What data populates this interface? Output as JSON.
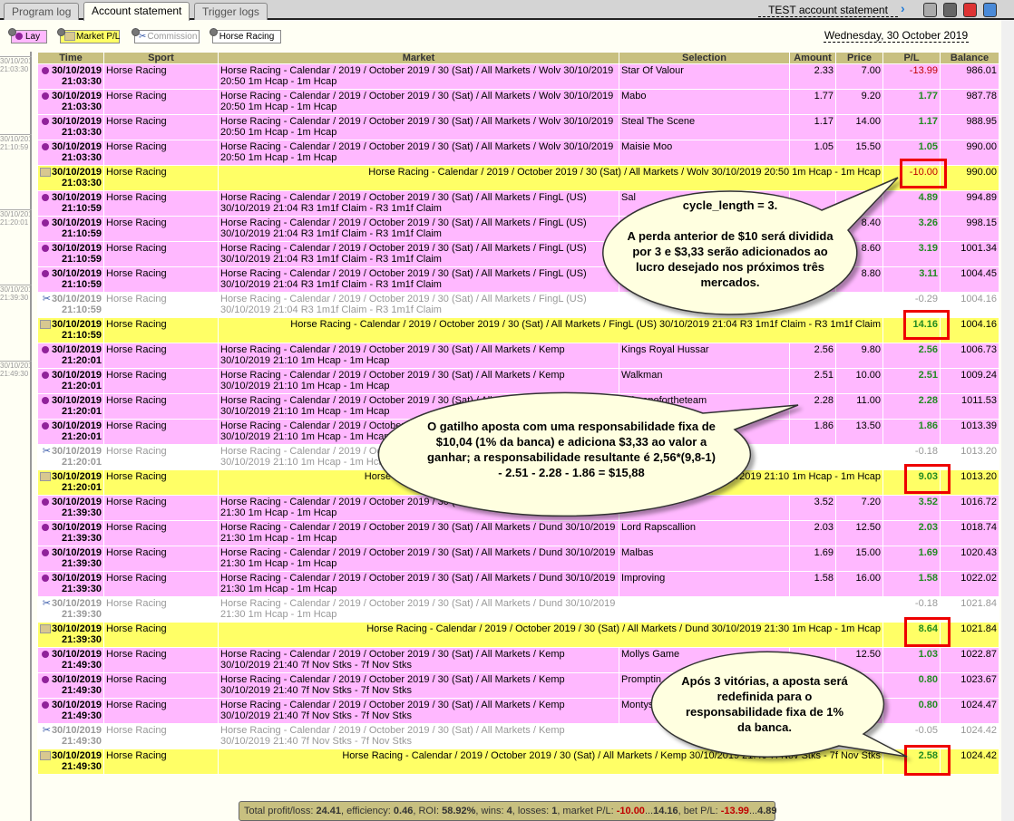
{
  "tabs": [
    {
      "label": "Program log"
    },
    {
      "label": "Account statement",
      "active": true
    },
    {
      "label": "Trigger logs"
    }
  ],
  "account_title": "TEST account statement",
  "toolbar_icons": [
    "arrow-right-icon",
    "refresh-icon",
    "save-icon",
    "print-icon",
    "download-icon"
  ],
  "filters": [
    {
      "label": "Lay",
      "icon": "lay-dot-icon",
      "color": "#ffb8ff"
    },
    {
      "label": "Market P/L",
      "icon": "market-pl-icon",
      "color": "#ffff66"
    },
    {
      "label": "Commission",
      "icon": "scissors-icon",
      "color": "#ffffff"
    },
    {
      "label": "Horse Racing",
      "icon": "",
      "color": "#ffffff"
    }
  ],
  "date": "Wednesday, 30 October 2019",
  "left_markers": [
    {
      "date": "30/10/2019",
      "time": "21:03:30"
    },
    {
      "date": "30/10/2019",
      "time": "21:10:59"
    },
    {
      "date": "30/10/2019",
      "time": "21:20:01"
    },
    {
      "date": "30/10/2019",
      "time": "21:39:30"
    },
    {
      "date": "30/10/2019",
      "time": "21:49:30"
    }
  ],
  "columns": [
    "Time",
    "Sport",
    "Market",
    "Selection",
    "Amount",
    "Price",
    "P/L",
    "Balance"
  ],
  "rows": [
    {
      "type": "lay",
      "date": "30/10/2019",
      "time": "21:03:30",
      "sport": "Horse Racing",
      "market": "Horse Racing - Calendar / 2019 / October 2019 / 30 (Sat) / All Markets / Wolv 30/10/2019 20:50 1m Hcap - 1m Hcap",
      "selection": "Star Of Valour",
      "amount": "2.33",
      "price": "7.00",
      "pl": "-13.99",
      "balance": "986.01"
    },
    {
      "type": "lay",
      "date": "30/10/2019",
      "time": "21:03:30",
      "sport": "Horse Racing",
      "market": "Horse Racing - Calendar / 2019 / October 2019 / 30 (Sat) / All Markets / Wolv 30/10/2019 20:50 1m Hcap - 1m Hcap",
      "selection": "Mabo",
      "amount": "1.77",
      "price": "9.20",
      "pl": "1.77",
      "balance": "987.78"
    },
    {
      "type": "lay",
      "date": "30/10/2019",
      "time": "21:03:30",
      "sport": "Horse Racing",
      "market": "Horse Racing - Calendar / 2019 / October 2019 / 30 (Sat) / All Markets / Wolv 30/10/2019 20:50 1m Hcap - 1m Hcap",
      "selection": "Steal The Scene",
      "amount": "1.17",
      "price": "14.00",
      "pl": "1.17",
      "balance": "988.95"
    },
    {
      "type": "lay",
      "date": "30/10/2019",
      "time": "21:03:30",
      "sport": "Horse Racing",
      "market": "Horse Racing - Calendar / 2019 / October 2019 / 30 (Sat) / All Markets / Wolv 30/10/2019 20:50 1m Hcap - 1m Hcap",
      "selection": "Maisie Moo",
      "amount": "1.05",
      "price": "15.50",
      "pl": "1.05",
      "balance": "990.00"
    },
    {
      "type": "mkt",
      "date": "30/10/2019",
      "time": "21:03:30",
      "sport": "Horse Racing",
      "market": "Horse Racing - Calendar / 2019 / October 2019 / 30 (Sat) / All Markets / Wolv 30/10/2019 20:50 1m Hcap - 1m Hcap",
      "pl": "-10.00",
      "balance": "990.00"
    },
    {
      "type": "lay",
      "date": "30/10/2019",
      "time": "21:10:59",
      "sport": "Horse Racing",
      "market": "Horse Racing - Calendar / 2019 / October 2019 / 30 (Sat) / All Markets / FingL (US) 30/10/2019 21:04 R3 1m1f Claim - R3 1m1f Claim",
      "selection": "Sal",
      "amount": "",
      "price": "",
      "pl": "4.89",
      "balance": "994.89"
    },
    {
      "type": "lay",
      "date": "30/10/2019",
      "time": "21:10:59",
      "sport": "Horse Racing",
      "market": "Horse Racing - Calendar / 2019 / October 2019 / 30 (Sat) / All Markets / FingL (US) 30/10/2019 21:04 R3 1m1f Claim - R3 1m1f Claim",
      "selection": "",
      "amount": "",
      "price": "8.40",
      "pl": "3.26",
      "balance": "998.15"
    },
    {
      "type": "lay",
      "date": "30/10/2019",
      "time": "21:10:59",
      "sport": "Horse Racing",
      "market": "Horse Racing - Calendar / 2019 / October 2019 / 30 (Sat) / All Markets / FingL (US) 30/10/2019 21:04 R3 1m1f Claim - R3 1m1f Claim",
      "selection": "",
      "amount": "",
      "price": "8.60",
      "pl": "3.19",
      "balance": "1001.34"
    },
    {
      "type": "lay",
      "date": "30/10/2019",
      "time": "21:10:59",
      "sport": "Horse Racing",
      "market": "Horse Racing - Calendar / 2019 / October 2019 / 30 (Sat) / All Markets / FingL (US) 30/10/2019 21:04 R3 1m1f Claim - R3 1m1f Claim",
      "selection": "",
      "amount": "",
      "price": "8.80",
      "pl": "3.11",
      "balance": "1004.45"
    },
    {
      "type": "comm",
      "date": "30/10/2019",
      "time": "21:10:59",
      "sport": "Horse Racing",
      "market": "Horse Racing - Calendar / 2019 / October 2019 / 30 (Sat) / All Markets / FingL (US) 30/10/2019 21:04 R3 1m1f Claim - R3 1m1f Claim",
      "selection": "",
      "amount": "",
      "price": "",
      "pl": "-0.29",
      "balance": "1004.16"
    },
    {
      "type": "mkt",
      "date": "30/10/2019",
      "time": "21:10:59",
      "sport": "Horse Racing",
      "market": "Horse Racing - Calendar / 2019 / October 2019 / 30 (Sat) / All Markets / FingL (US) 30/10/2019 21:04 R3 1m1f Claim - R3 1m1f Claim",
      "pl": "14.16",
      "balance": "1004.16"
    },
    {
      "type": "lay",
      "date": "30/10/2019",
      "time": "21:20:01",
      "sport": "Horse Racing",
      "market": "Horse Racing - Calendar / 2019 / October 2019 / 30 (Sat) / All Markets / Kemp 30/10/2019 21:10 1m Hcap - 1m Hcap",
      "selection": "Kings Royal Hussar",
      "amount": "2.56",
      "price": "9.80",
      "pl": "2.56",
      "balance": "1006.73"
    },
    {
      "type": "lay",
      "date": "30/10/2019",
      "time": "21:20:01",
      "sport": "Horse Racing",
      "market": "Horse Racing - Calendar / 2019 / October 2019 / 30 (Sat) / All Markets / Kemp 30/10/2019 21:10 1m Hcap - 1m Hcap",
      "selection": "Walkman",
      "amount": "2.51",
      "price": "10.00",
      "pl": "2.51",
      "balance": "1009.24"
    },
    {
      "type": "lay",
      "date": "30/10/2019",
      "time": "21:20:01",
      "sport": "Horse Racing",
      "market": "Horse Racing - Calendar / 2019 / October 2019 / 30 (Sat) / All Markets / Kemp 30/10/2019 21:10 1m Hcap - 1m Hcap",
      "selection": "Takeonefortheteam",
      "amount": "2.28",
      "price": "11.00",
      "pl": "2.28",
      "balance": "1011.53"
    },
    {
      "type": "lay",
      "date": "30/10/2019",
      "time": "21:20:01",
      "sport": "Horse Racing",
      "market": "Horse Racing - Calendar / 2019 / October 2019 / 30 (Sat) / All Markets / Kemp 30/10/2019 21:10 1m Hcap - 1m Hcap",
      "selection": "",
      "amount": "1.86",
      "price": "13.50",
      "pl": "1.86",
      "balance": "1013.39"
    },
    {
      "type": "comm",
      "date": "30/10/2019",
      "time": "21:20:01",
      "sport": "Horse Racing",
      "market": "Horse Racing - Calendar / 2019 / October 2019 / 30 (Sat) / All Markets / Kemp 30/10/2019 21:10 1m Hcap - 1m Hcap",
      "selection": "",
      "amount": "",
      "price": "",
      "pl": "-0.18",
      "balance": "1013.20"
    },
    {
      "type": "mkt",
      "date": "30/10/2019",
      "time": "21:20:01",
      "sport": "Horse Racing",
      "market": "Horse Racing - Calendar / 2019 / October 2019 / 30 (Sat) / All Markets / Kemp 30/10/2019 21:10 1m Hcap - 1m Hcap",
      "pl": "9.03",
      "balance": "1013.20"
    },
    {
      "type": "lay",
      "date": "30/10/2019",
      "time": "21:39:30",
      "sport": "Horse Racing",
      "market": "Horse Racing - Calendar / 2019 / October 2019 / 30 (Sat) / All Markets / Dund 30/10/2019 21:30 1m Hcap - 1m Hcap",
      "selection": "",
      "amount": "3.52",
      "price": "7.20",
      "pl": "3.52",
      "balance": "1016.72"
    },
    {
      "type": "lay",
      "date": "30/10/2019",
      "time": "21:39:30",
      "sport": "Horse Racing",
      "market": "Horse Racing - Calendar / 2019 / October 2019 / 30 (Sat) / All Markets / Dund 30/10/2019 21:30 1m Hcap - 1m Hcap",
      "selection": "Lord Rapscallion",
      "amount": "2.03",
      "price": "12.50",
      "pl": "2.03",
      "balance": "1018.74"
    },
    {
      "type": "lay",
      "date": "30/10/2019",
      "time": "21:39:30",
      "sport": "Horse Racing",
      "market": "Horse Racing - Calendar / 2019 / October 2019 / 30 (Sat) / All Markets / Dund 30/10/2019 21:30 1m Hcap - 1m Hcap",
      "selection": "Malbas",
      "amount": "1.69",
      "price": "15.00",
      "pl": "1.69",
      "balance": "1020.43"
    },
    {
      "type": "lay",
      "date": "30/10/2019",
      "time": "21:39:30",
      "sport": "Horse Racing",
      "market": "Horse Racing - Calendar / 2019 / October 2019 / 30 (Sat) / All Markets / Dund 30/10/2019 21:30 1m Hcap - 1m Hcap",
      "selection": "Improving",
      "amount": "1.58",
      "price": "16.00",
      "pl": "1.58",
      "balance": "1022.02"
    },
    {
      "type": "comm",
      "date": "30/10/2019",
      "time": "21:39:30",
      "sport": "Horse Racing",
      "market": "Horse Racing - Calendar / 2019 / October 2019 / 30 (Sat) / All Markets / Dund 30/10/2019 21:30 1m Hcap - 1m Hcap",
      "selection": "",
      "amount": "",
      "price": "",
      "pl": "-0.18",
      "balance": "1021.84"
    },
    {
      "type": "mkt",
      "date": "30/10/2019",
      "time": "21:39:30",
      "sport": "Horse Racing",
      "market": "Horse Racing - Calendar / 2019 / October 2019 / 30 (Sat) / All Markets / Dund 30/10/2019 21:30 1m Hcap - 1m Hcap",
      "pl": "8.64",
      "balance": "1021.84"
    },
    {
      "type": "lay",
      "date": "30/10/2019",
      "time": "21:49:30",
      "sport": "Horse Racing",
      "market": "Horse Racing - Calendar / 2019 / October 2019 / 30 (Sat) / All Markets / Kemp 30/10/2019 21:40 7f Nov Stks - 7f Nov Stks",
      "selection": "Mollys Game",
      "amount": "",
      "price": "12.50",
      "pl": "1.03",
      "balance": "1022.87"
    },
    {
      "type": "lay",
      "date": "30/10/2019",
      "time": "21:49:30",
      "sport": "Horse Racing",
      "market": "Horse Racing - Calendar / 2019 / October 2019 / 30 (Sat) / All Markets / Kemp 30/10/2019 21:40 7f Nov Stks - 7f Nov Stks",
      "selection": "Promptin",
      "amount": "",
      "price": "",
      "pl": "0.80",
      "balance": "1023.67"
    },
    {
      "type": "lay",
      "date": "30/10/2019",
      "time": "21:49:30",
      "sport": "Horse Racing",
      "market": "Horse Racing - Calendar / 2019 / October 2019 / 30 (Sat) / All Markets / Kemp 30/10/2019 21:40 7f Nov Stks - 7f Nov Stks",
      "selection": "Montys",
      "amount": "",
      "price": "",
      "pl": "0.80",
      "balance": "1024.47"
    },
    {
      "type": "comm",
      "date": "30/10/2019",
      "time": "21:49:30",
      "sport": "Horse Racing",
      "market": "Horse Racing - Calendar / 2019 / October 2019 / 30 (Sat) / All Markets / Kemp 30/10/2019 21:40 7f Nov Stks - 7f Nov Stks",
      "selection": "",
      "amount": "",
      "price": "",
      "pl": "-0.05",
      "balance": "1024.42"
    },
    {
      "type": "mkt",
      "date": "30/10/2019",
      "time": "21:49:30",
      "sport": "Horse Racing",
      "market": "Horse Racing - Calendar / 2019 / October 2019 / 30 (Sat) / All Markets / Kemp 30/10/2019 21:40 7f Nov Stks - 7f Nov Stks",
      "pl": "2.58",
      "balance": "1024.42"
    }
  ],
  "footer": {
    "l1": "Total profit/loss: ",
    "v1": "24.41",
    "l2": ", efficiency: ",
    "v2": "0.46",
    "l3": ", ROI: ",
    "v3": "58.92%",
    "l4": ", wins: ",
    "v4": "4",
    "l5": ", losses: ",
    "v5": "1",
    "l6": ", market P/L: ",
    "v6": "-10.00",
    "sep1": "...",
    "v7": "14.16",
    "l7": ", bet P/L: ",
    "v8": "-13.99",
    "sep2": "...",
    "v9": "4.89"
  },
  "callouts": [
    {
      "text": "cycle_length = 3.\n\nA perda anterior de $10 será dividida por 3 e $3,33 serão adicionados ao lucro desejado nos próximos três mercados."
    },
    {
      "text": "O gatilho aposta com uma responsabilidade fixa de $10,04 (1% da banca) e adiciona $3,33 ao valor a ganhar; a responsabilidade resultante é 2,56*(9,8-1) - 2.51 - 2.28 - 1.86 = $15,88"
    },
    {
      "text": "Após 3 vitórias, a aposta será redefinida para o responsabilidade fixa de 1% da banca."
    }
  ],
  "colors": {
    "lay": "#ffb8ff",
    "market_pl": "#ffff66",
    "header": "#c8c080",
    "callout": "#ffffe0",
    "highlight": "#ee0000",
    "positive": "#228b22",
    "negative": "#c00000"
  }
}
